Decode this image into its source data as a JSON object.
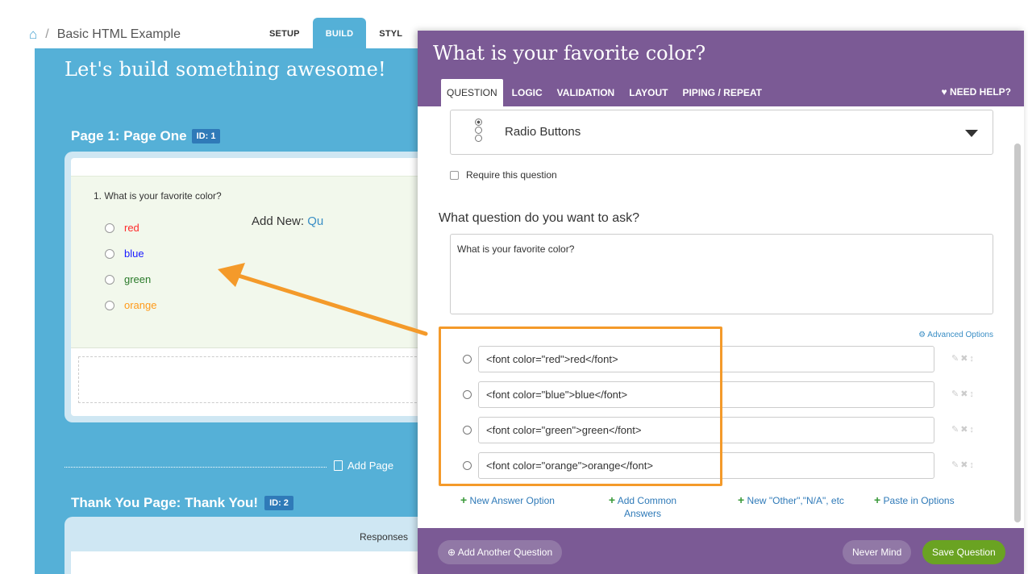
{
  "breadcrumb": {
    "home_icon": "home-icon",
    "separator": "/",
    "project": "Basic HTML Example"
  },
  "nav_tabs": [
    {
      "label": "SETUP",
      "active": false
    },
    {
      "label": "BUILD",
      "active": true
    },
    {
      "label": "STYL",
      "active": false
    }
  ],
  "builder": {
    "headline": "Let's build something awesome!",
    "page1": {
      "title": "Page 1: Page One",
      "id_badge": "ID: 1"
    },
    "question": {
      "text": "1. What is your favorite color?",
      "options": [
        {
          "label": "red",
          "color": "#ff2b2b"
        },
        {
          "label": "blue",
          "color": "#1a1aff"
        },
        {
          "label": "green",
          "color": "#2a7a2a"
        },
        {
          "label": "orange",
          "color": "#ff9a1a"
        }
      ]
    },
    "add_new_label": "Add New:",
    "add_new_link": "Qu",
    "add_page": "Add Page",
    "page2": {
      "title": "Thank You Page: Thank You!",
      "id_badge": "ID: 2"
    },
    "responses": "Responses"
  },
  "modal": {
    "title": "What is your favorite color?",
    "tabs": [
      {
        "label": "QUESTION",
        "active": true
      },
      {
        "label": "LOGIC",
        "active": false
      },
      {
        "label": "VALIDATION",
        "active": false
      },
      {
        "label": "LAYOUT",
        "active": false
      },
      {
        "label": "PIPING / REPEAT",
        "active": false
      }
    ],
    "need_help": "♥ NEED HELP?",
    "question_type": "Radio Buttons",
    "require_label": "Require this question",
    "ask_label": "What question do you want to ask?",
    "ask_value": "What is your favorite color?",
    "advanced_options": "⚙ Advanced Options",
    "answers": [
      "<font color=\"red\">red</font>",
      "<font color=\"blue\">blue</font>",
      "<font color=\"green\">green</font>",
      "<font color=\"orange\">orange</font>"
    ],
    "links": {
      "new_answer": "New Answer Option",
      "add_common": "Add Common Answers",
      "new_other": "New \"Other\",\"N/A\", etc",
      "paste": "Paste in Options"
    },
    "footer": {
      "add_another": "Add Another Question",
      "never_mind": "Never Mind",
      "save": "Save Question"
    }
  },
  "colors": {
    "builder_bg": "#55b0d7",
    "modal_purple": "#7b5a95",
    "highlight_orange": "#f49a2a",
    "save_green": "#6aa322"
  }
}
